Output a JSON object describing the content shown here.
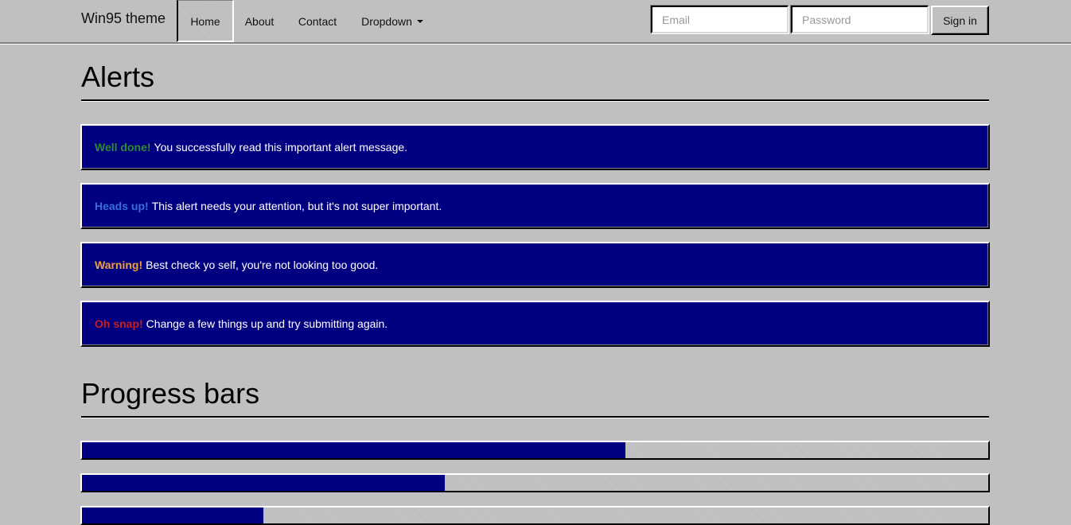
{
  "navbar": {
    "brand": "Win95 theme",
    "items": [
      {
        "label": "Home",
        "active": true
      },
      {
        "label": "About"
      },
      {
        "label": "Contact"
      },
      {
        "label": "Dropdown",
        "has_caret": true
      }
    ],
    "form": {
      "email_placeholder": "Email",
      "password_placeholder": "Password",
      "signin_label": "Sign in"
    }
  },
  "alerts_section": {
    "title": "Alerts",
    "alerts": [
      {
        "strong": "Well done!",
        "text": "You successfully read this important alert message.",
        "strong_color": "#2e8b2e"
      },
      {
        "strong": "Heads up!",
        "text": "This alert needs your attention, but it's not super important.",
        "strong_color": "#3a6fd8"
      },
      {
        "strong": "Warning!",
        "text": "Best check yo self, you're not looking too good.",
        "strong_color": "#f0a040"
      },
      {
        "strong": "Oh snap!",
        "text": "Change a few things up and try submitting again.",
        "strong_color": "#c81e1e"
      }
    ]
  },
  "progress_section": {
    "title": "Progress bars",
    "bars": [
      {
        "percent": 60
      },
      {
        "percent": 40
      },
      {
        "percent": 20
      }
    ]
  },
  "colors": {
    "window_gray": "#c0c0c0",
    "alert_navy": "#000080",
    "progress_fill": "#000080"
  }
}
